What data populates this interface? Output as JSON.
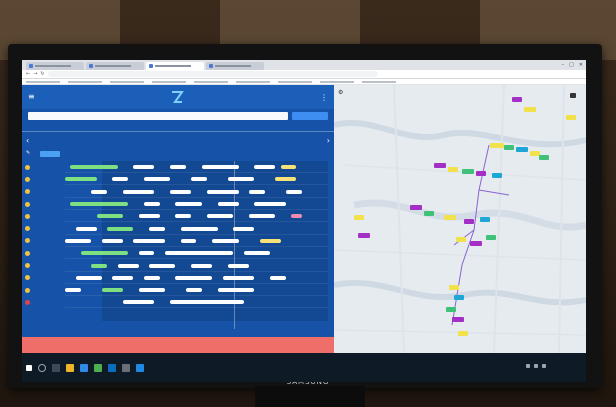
{
  "monitor": {
    "brand": "SAMSUNG"
  },
  "browser": {
    "tabs": [
      "",
      "",
      "",
      ""
    ],
    "url": ""
  },
  "app": {
    "search_placeholder": "",
    "search_button": "",
    "tabs": [
      "",
      "",
      ""
    ],
    "date_title": "",
    "date_sub": "",
    "time_ticks": [
      "",
      "",
      "",
      "",
      "",
      "",
      "",
      "",
      "",
      "",
      "",
      ""
    ],
    "filter_label": "",
    "now_label": "",
    "footer_button": "",
    "users": [
      {
        "name": "",
        "color": "#f2c13d"
      },
      {
        "name": "",
        "color": "#f2c13d"
      },
      {
        "name": "",
        "color": "#f2c13d"
      },
      {
        "name": "",
        "color": "#f2c13d"
      },
      {
        "name": "",
        "color": "#f2c13d"
      },
      {
        "name": "",
        "color": "#f2c13d"
      },
      {
        "name": "",
        "color": "#f2c13d"
      },
      {
        "name": "",
        "color": "#f2c13d"
      },
      {
        "name": "",
        "color": "#f2c13d"
      },
      {
        "name": "",
        "color": "#f2c13d"
      },
      {
        "name": "",
        "color": "#f2c13d"
      },
      {
        "name": "",
        "color": "#e04444"
      }
    ]
  },
  "map": {
    "markers": []
  },
  "taskbar": {
    "time": "",
    "date": ""
  },
  "colors": {
    "app_blue": "#1653a8",
    "accent": "#3d8ef0",
    "footer": "#f06e6a",
    "segment_white": "#ffffff",
    "segment_green": "#7ee081",
    "segment_yellow": "#f7e27a"
  }
}
